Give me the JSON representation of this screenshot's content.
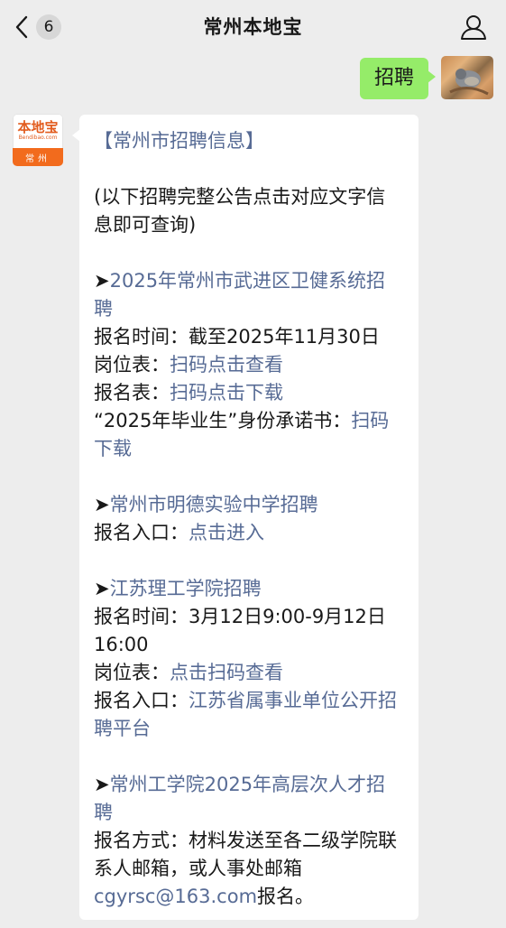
{
  "header": {
    "back_count": "6",
    "title": "常州本地宝"
  },
  "outgoing": {
    "text": "招聘"
  },
  "bot": {
    "logo_name": "本地宝",
    "logo_sub": "Bendibao.com",
    "city": "常州"
  },
  "message": {
    "heading": "【常州市招聘信息】",
    "intro": "(以下招聘完整公告点击对应文字信息即可查询)",
    "arrow": "➤",
    "item1": {
      "title": "2025年常州市武进区卫健系统招聘",
      "time_label": "报名时间：截至2025年11月30日",
      "posts_label": "岗位表：",
      "posts_link": "扫码点击查看",
      "form_label": "报名表：",
      "form_link": "扫码点击下载",
      "commit_label": "“2025年毕业生”身份承诺书：",
      "commit_link": "扫码下载"
    },
    "item2": {
      "title": "常州市明德实验中学招聘",
      "entry_label": "报名入口：",
      "entry_link": "点击进入"
    },
    "item3": {
      "title": "江苏理工学院招聘",
      "time_label": "报名时间：3月12日9:00-9月12日16:00",
      "posts_label": "岗位表：",
      "posts_link": "点击扫码查看",
      "entry_label": "报名入口：",
      "entry_link": "江苏省属事业单位公开招聘平台"
    },
    "item4": {
      "title": "常州工学院2025年高层次人才招聘",
      "method_label": "报名方式：材料发送至各二级学院联系人邮箱，或人事处邮箱",
      "email": "cgyrsc@163.com",
      "tail": "报名。"
    }
  }
}
